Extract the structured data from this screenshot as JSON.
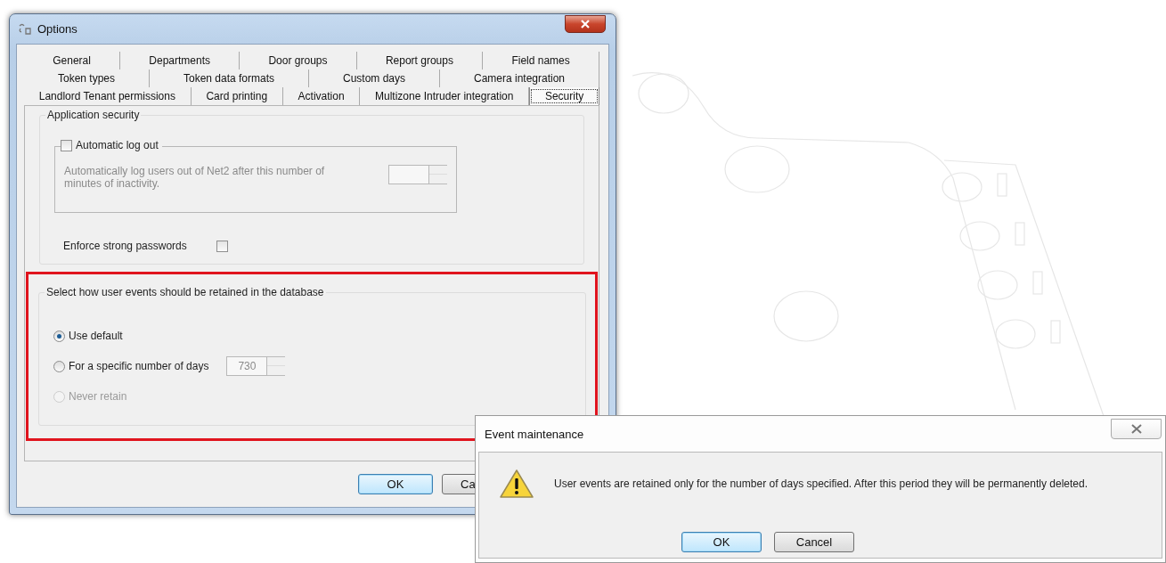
{
  "window": {
    "title": "Options"
  },
  "tab_rows": [
    {
      "tabs": [
        {
          "label": "General",
          "selected": false
        },
        {
          "label": "Departments",
          "selected": false
        },
        {
          "label": "Door groups",
          "selected": false
        },
        {
          "label": "Report groups",
          "selected": false
        },
        {
          "label": "Field names",
          "selected": false
        }
      ]
    },
    {
      "tabs": [
        {
          "label": "Token types",
          "selected": false
        },
        {
          "label": "Token data formats",
          "selected": false
        },
        {
          "label": "Custom days",
          "selected": false
        },
        {
          "label": "Camera integration",
          "selected": false
        }
      ]
    },
    {
      "tabs": [
        {
          "label": "Landlord Tenant permissions",
          "selected": false
        },
        {
          "label": "Card printing",
          "selected": false
        },
        {
          "label": "Activation",
          "selected": false
        },
        {
          "label": "Multizone Intruder integration",
          "selected": false
        },
        {
          "label": "Security",
          "selected": true
        }
      ]
    }
  ],
  "application_security": {
    "title": "Application security",
    "auto_logout": {
      "label": "Automatic log out",
      "checked": false,
      "description": "Automatically log users out of Net2 after this number of minutes of inactivity."
    },
    "strong_passwords": {
      "label": "Enforce strong passwords",
      "checked": false
    }
  },
  "event_retention": {
    "title": "Select how user events should be retained in the database",
    "highlighted": true,
    "options": [
      {
        "label": "Use default",
        "selected": true,
        "disabled": false
      },
      {
        "label": "For a specific number of days",
        "selected": false,
        "disabled": false,
        "value": "730"
      },
      {
        "label": "Never retain",
        "selected": false,
        "disabled": true
      }
    ]
  },
  "buttons": [
    {
      "label": "OK",
      "default": true
    },
    {
      "label": "Ca",
      "default": false
    }
  ],
  "dialog": {
    "title": "Event maintenance",
    "message": "User events are retained only for the number of days specified. After this period they will be permanently deleted.",
    "buttons": [
      {
        "label": "OK",
        "default": true
      },
      {
        "label": "Cancel",
        "default": false
      }
    ]
  }
}
